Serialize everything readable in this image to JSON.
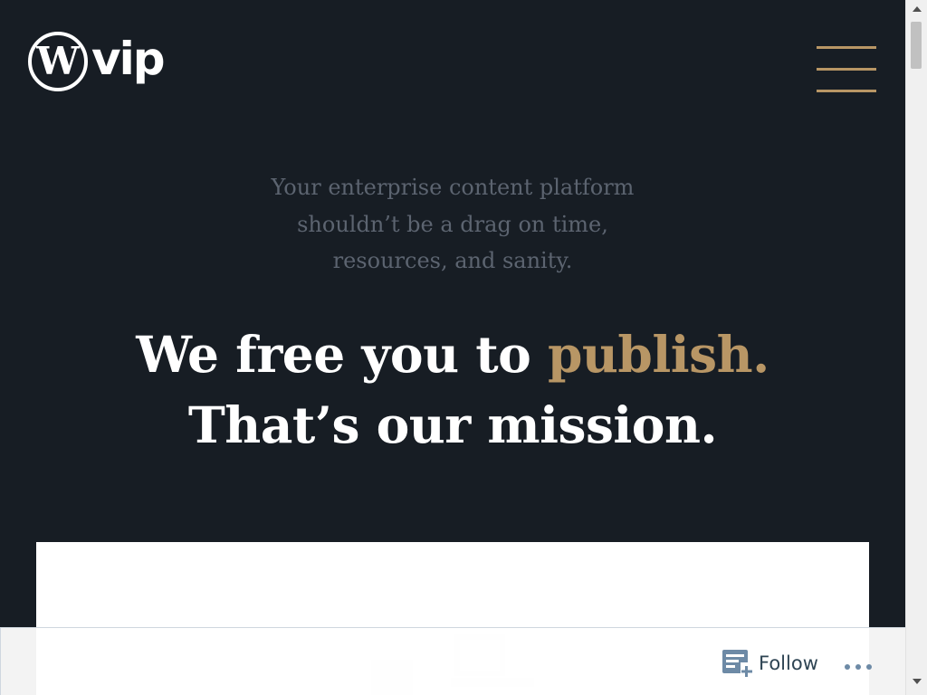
{
  "header": {
    "logo_text": "vip",
    "logo_icon": "wordpress-logo-icon",
    "menu_icon": "hamburger-menu-icon"
  },
  "hero": {
    "subtitle_lines": [
      "Your enterprise content platform",
      "shouldn’t be a drag on time,",
      "resources, and sanity."
    ],
    "headline_line1_prefix": "We free you to",
    "headline_line1_accent": "publish.",
    "headline_line2": "That’s our mission."
  },
  "follow_bar": {
    "follow_label": "Follow",
    "follow_icon": "reader-follow-icon",
    "more_icon": "ellipsis-icon"
  },
  "colors": {
    "background": "#171d24",
    "accent": "#b89665",
    "subtitle": "#5c6470",
    "headline": "#ffffff"
  }
}
